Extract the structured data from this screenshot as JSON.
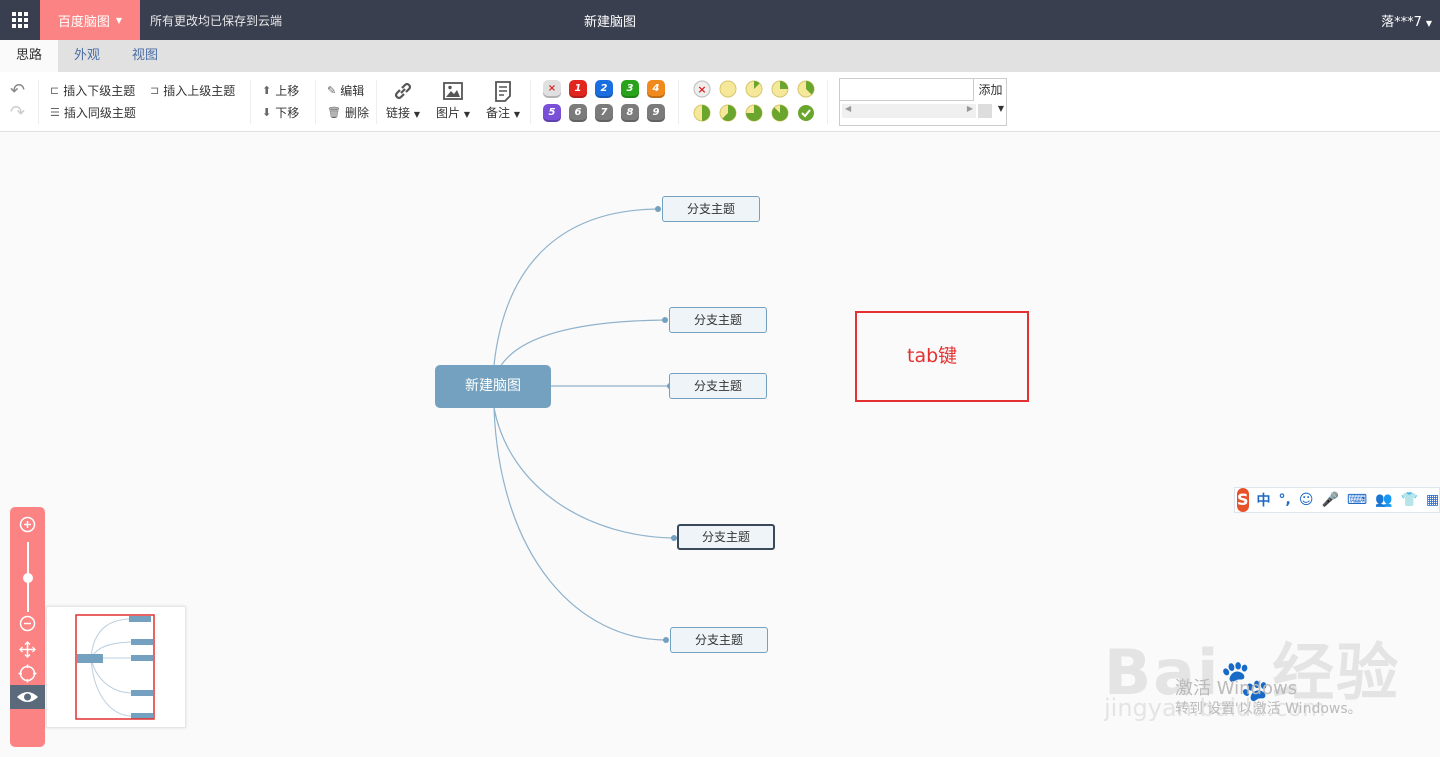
{
  "topbar": {
    "brand": "百度脑图",
    "save_status": "所有更改均已保存到云端",
    "doc_title": "新建脑图",
    "user": "落***7"
  },
  "tabs": [
    {
      "label": "思路",
      "active": true
    },
    {
      "label": "外观",
      "active": false
    },
    {
      "label": "视图",
      "active": false
    }
  ],
  "toolbar": {
    "insert_child": "插入下级主题",
    "insert_parent": "插入上级主题",
    "insert_sibling": "插入同级主题",
    "move_up": "上移",
    "move_down": "下移",
    "edit": "编辑",
    "delete": "删除",
    "link": "链接",
    "image": "图片",
    "note": "备注",
    "priorities": [
      {
        "label": "×",
        "color": "#e0e0e0",
        "text_color": "#d22"
      },
      {
        "label": "1",
        "color": "#e0261f"
      },
      {
        "label": "2",
        "color": "#1a6ee0"
      },
      {
        "label": "3",
        "color": "#2aa31c"
      },
      {
        "label": "4",
        "color": "#f08a1c"
      },
      {
        "label": "5",
        "color": "#7a50d8"
      },
      {
        "label": "6",
        "color": "#7b7b7b"
      },
      {
        "label": "7",
        "color": "#7b7b7b"
      },
      {
        "label": "8",
        "color": "#7b7b7b"
      },
      {
        "label": "9",
        "color": "#7b7b7b"
      }
    ],
    "progress": [
      0,
      0,
      0.125,
      0.25,
      0.375,
      0.5,
      0.625,
      0.75,
      0.875,
      1
    ],
    "search_placeholder": "",
    "search_add": "添加"
  },
  "mindmap": {
    "root": "新建脑图",
    "branches": [
      {
        "label": "分支主题",
        "selected": false
      },
      {
        "label": "分支主题",
        "selected": false
      },
      {
        "label": "分支主题",
        "selected": false
      },
      {
        "label": "分支主题",
        "selected": true
      },
      {
        "label": "分支主题",
        "selected": false
      }
    ]
  },
  "annotation": "tab键",
  "ime": {
    "logo": "S",
    "items": [
      "中",
      "°,",
      "☺",
      "🎤",
      "⌨",
      "👥",
      "👕",
      "▦"
    ]
  },
  "watermark": {
    "baidu": "Bai",
    "jingyan": "经验",
    "url": "jingyan.baidu.com",
    "win_activate": "激活 Windows",
    "win_hint": "转到'设置'以激活 Windows。"
  }
}
